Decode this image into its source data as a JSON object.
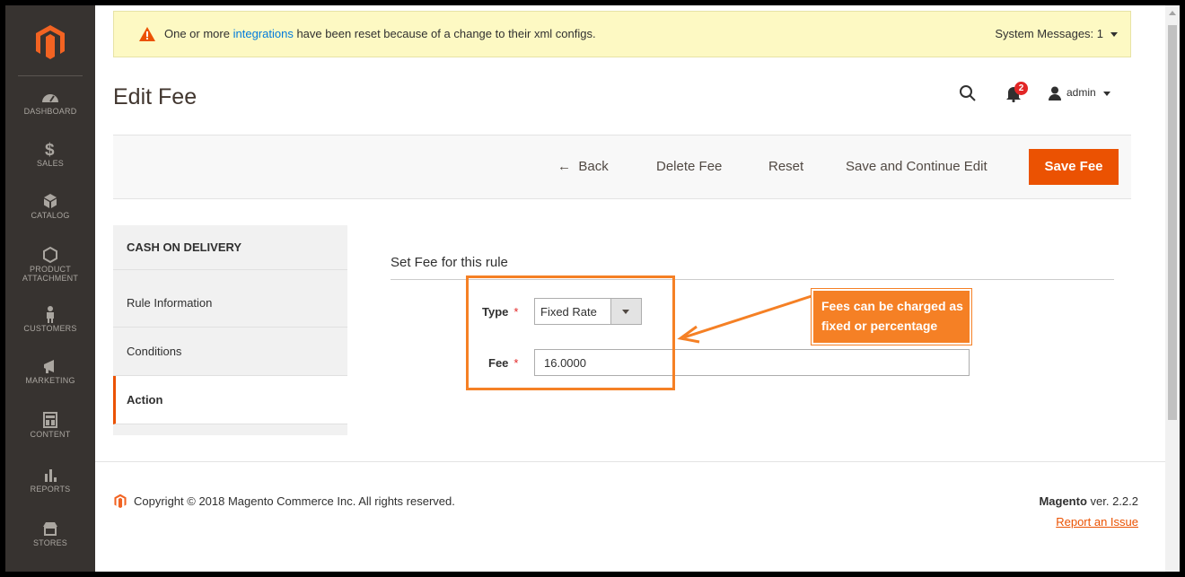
{
  "system_message": {
    "text_before": "One or more",
    "link": "integrations",
    "text_after": "have been reset because of a change to their xml configs.",
    "counter": "System Messages: 1"
  },
  "sidebar": {
    "items": [
      {
        "label": "DASHBOARD",
        "icon": "dashboard-icon"
      },
      {
        "label": "SALES",
        "icon": "dollar-icon"
      },
      {
        "label": "CATALOG",
        "icon": "cube-icon"
      },
      {
        "label": "PRODUCT",
        "label2": "ATTACHMENT",
        "icon": "hexagon-icon"
      },
      {
        "label": "CUSTOMERS",
        "icon": "person-icon"
      },
      {
        "label": "MARKETING",
        "icon": "megaphone-icon"
      },
      {
        "label": "CONTENT",
        "icon": "layout-icon"
      },
      {
        "label": "REPORTS",
        "icon": "bar-chart-icon"
      },
      {
        "label": "STORES",
        "icon": "store-icon"
      }
    ]
  },
  "header": {
    "title": "Edit Fee",
    "notifications_count": "2",
    "user": "admin"
  },
  "actions": {
    "back": "Back",
    "delete": "Delete Fee",
    "reset": "Reset",
    "save_continue": "Save and Continue Edit",
    "save": "Save Fee"
  },
  "left_nav": {
    "title": "CASH ON DELIVERY",
    "items": [
      "Rule Information",
      "Conditions",
      "Action"
    ]
  },
  "form": {
    "section_title": "Set Fee for this rule",
    "type_label": "Type",
    "type_value": "Fixed Rate",
    "fee_label": "Fee",
    "fee_value": "16.0000",
    "required_mark": "*"
  },
  "annotation": {
    "line1": "Fees can be charged as",
    "line2": "fixed or percentage"
  },
  "footer": {
    "copyright": "Copyright © 2018 Magento Commerce Inc. All rights reserved.",
    "brand": "Magento",
    "version": "ver. 2.2.2",
    "report": "Report an Issue"
  },
  "colors": {
    "accent": "#eb5202",
    "annotation": "#f58025",
    "sidebar": "#373330",
    "message_bg": "#fdf9c3"
  }
}
